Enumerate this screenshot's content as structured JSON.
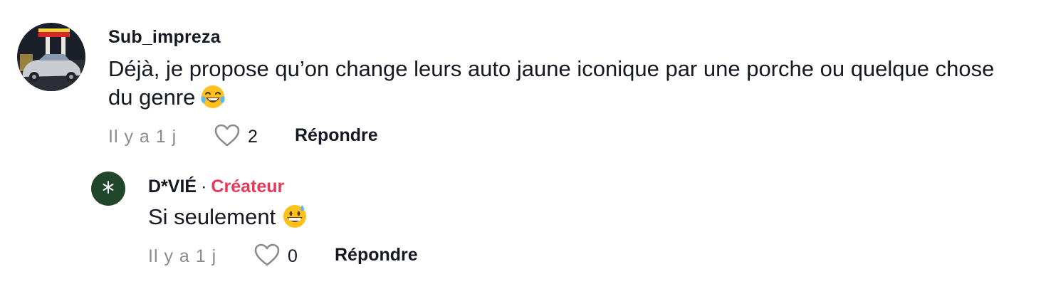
{
  "comment": {
    "username": "Sub_impreza",
    "text": "Déjà, je propose qu’on change leurs auto jaune iconique par une porche ou quelque chose du genre",
    "emoji": "face-with-tears-of-joy",
    "time": "Il y a 1 j",
    "like_count": "2",
    "reply_label": "Répondre"
  },
  "reply": {
    "username": "D*VIÉ",
    "separator": "·",
    "badge": "Créateur",
    "text": "Si seulement",
    "emoji": "grinning-face-with-sweat",
    "time": "Il y a 1 j",
    "like_count": "0",
    "reply_label": "Répondre"
  },
  "colors": {
    "primary_text": "#161823",
    "secondary_text": "#8a8b91",
    "creator_badge": "#e23c5d",
    "creator_avatar_bg": "#21472a"
  },
  "icons": {
    "like": "heart-outline-icon",
    "creator_avatar": "asterisk-icon"
  }
}
